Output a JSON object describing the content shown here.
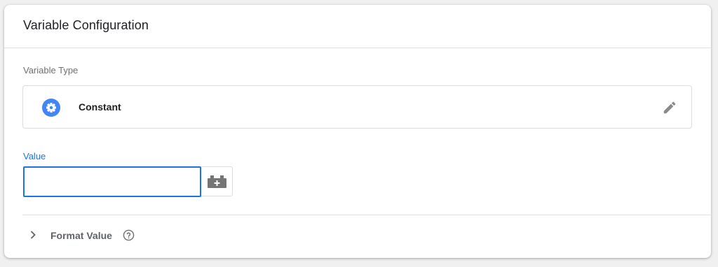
{
  "card": {
    "title": "Variable Configuration"
  },
  "variable_type": {
    "section_label": "Variable Type",
    "selected_type": "Constant",
    "type_icon": "gear-icon",
    "edit_icon": "pencil-icon"
  },
  "value_field": {
    "label": "Value",
    "value": "",
    "placeholder": "",
    "picker_icon": "add-variable-icon"
  },
  "format_value": {
    "label": "Format Value",
    "expand_icon": "chevron-right-icon",
    "help_icon": "help-circle-icon"
  },
  "colors": {
    "accent": "#1a73e8",
    "icon_blue": "#4285f4",
    "icon_gray": "#757575",
    "text_primary": "#202124",
    "text_secondary": "#6f6f6f"
  }
}
